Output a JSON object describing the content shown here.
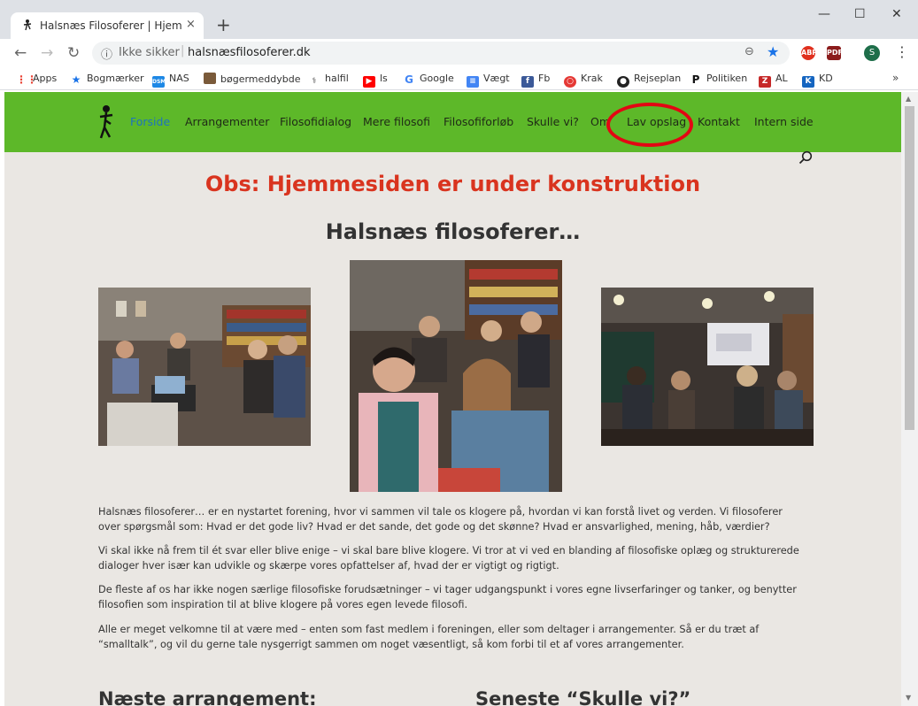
{
  "browser": {
    "tab_title": "Halsnæs Filosoferer | Hjemmesid",
    "tab_close": "×",
    "new_tab": "+",
    "win_min": "—",
    "win_max": "☐",
    "win_close": "✕",
    "security_label": "Ikke sikker",
    "url": "halsnæsfilosoferer.dk",
    "profile_initial": "S",
    "extensions": [
      {
        "name": "abp",
        "label": "ABP",
        "color": "#e0301e"
      },
      {
        "name": "pdf",
        "label": "PDF",
        "color": "#8b1c1c"
      }
    ]
  },
  "bookmarks": [
    {
      "label": "Apps",
      "icon": "apps-grid-icon",
      "color": "#4285f4"
    },
    {
      "label": "Bogmærker",
      "icon": "star-icon",
      "color": "#1a73e8"
    },
    {
      "label": "NAS",
      "icon": "nas-icon",
      "color": "#1e88e5"
    },
    {
      "label": "bøgermeddybde",
      "icon": "books-icon",
      "color": "#7a5a3a"
    },
    {
      "label": "halfil",
      "icon": "halfil-icon",
      "color": "#333333"
    },
    {
      "label": "ls",
      "icon": "youtube-icon",
      "color": "#ff0000"
    },
    {
      "label": "Google",
      "icon": "google-icon",
      "color": "#4285f4"
    },
    {
      "label": "Vægt",
      "icon": "docs-icon",
      "color": "#4285f4"
    },
    {
      "label": "Fb",
      "icon": "facebook-icon",
      "color": "#3b5998"
    },
    {
      "label": "Krak",
      "icon": "krak-icon",
      "color": "#e53935"
    },
    {
      "label": "Rejseplan",
      "icon": "rejseplan-icon",
      "color": "#222222"
    },
    {
      "label": "Politiken",
      "icon": "politiken-icon",
      "color": "#111111"
    },
    {
      "label": "AL",
      "icon": "al-icon",
      "color": "#c62828"
    },
    {
      "label": "KD",
      "icon": "kd-icon",
      "color": "#1565c0"
    }
  ],
  "bookmarks_more": "»",
  "site": {
    "nav": [
      "Forside",
      "Arrangementer",
      "Filosofidialog",
      "Mere filosofi",
      "Filosofiforløb",
      "Skulle vi?",
      "Om",
      "Lav opslag",
      "Kontakt",
      "Intern side"
    ],
    "active_nav": "Forside",
    "nav_color": "#5db829",
    "notice": "Obs: Hjemmesiden er under konstruktion",
    "heading": "Halsnæs filosoferer…",
    "paragraphs": [
      "Halsnæs filosoferer… er en nystartet forening, hvor vi sammen vil tale os klogere på, hvordan vi kan forstå livet og verden. Vi filosoferer over spørgsmål som: Hvad er det gode liv? Hvad er det sande, det gode og det skønne? Hvad er ansvarlighed, mening, håb, værdier?",
      "Vi skal ikke nå frem til ét svar eller blive enige – vi skal bare blive klogere. Vi tror at vi ved en blanding af filosofiske oplæg og strukturerede dialoger hver især kan udvikle og skærpe vores opfattelser af, hvad der er vigtigt og rigtigt.",
      "De fleste af os har ikke nogen særlige filosofiske forudsætninger – vi tager udgangspunkt i vores egne livserfaringer og tanker, og benytter filosofien som  inspiration til at blive klogere på vores egen levede filosofi.",
      "Alle er meget velkomne til at være med – enten som fast medlem i foreningen, eller som deltager i arrangementer. Så er du træt af “smalltalk”, og vil du gerne tale nysgerrigt sammen om noget væsentligt, så kom forbi til et af vores arrangementer."
    ],
    "section_next": "Næste arrangement:",
    "section_latest": "Seneste “Skulle vi?”"
  }
}
